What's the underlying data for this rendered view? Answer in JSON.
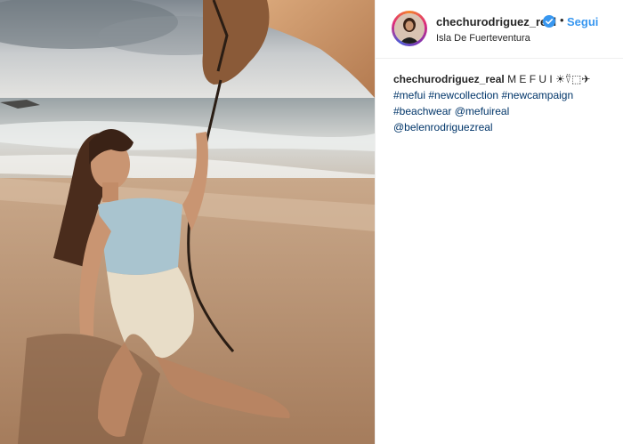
{
  "post": {
    "username": "chechurodriguez_real",
    "separator": "•",
    "follow_label": "Segui",
    "location": "Isla De Fuerteventura",
    "caption": {
      "username": "chechurodriguez_real",
      "text": "M E F U I ☀⍢⬚✈",
      "hashtags": [
        "#mefui",
        "#newcollection",
        "#newcampaign",
        "#beachwear"
      ],
      "mentions": [
        "@mefuireal",
        "@belenrodriguezreal"
      ]
    }
  },
  "colors": {
    "link_blue": "#3897f0",
    "tag_blue": "#003569",
    "text": "#262626",
    "verified": "#3897f0"
  },
  "icons": {
    "verified": "verified-badge-icon"
  }
}
